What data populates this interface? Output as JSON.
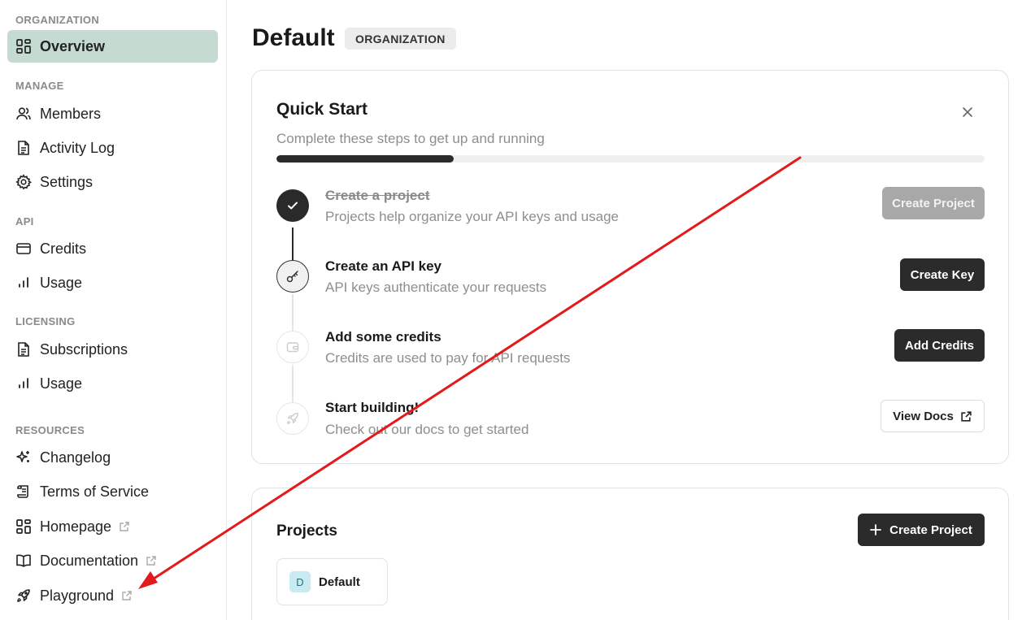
{
  "sidebar": {
    "sections": [
      {
        "label": "ORGANIZATION",
        "items": [
          {
            "label": "Overview",
            "icon": "layout-grid-icon",
            "active": true
          }
        ]
      },
      {
        "label": "MANAGE",
        "items": [
          {
            "label": "Members",
            "icon": "users-icon"
          },
          {
            "label": "Activity Log",
            "icon": "file-text-icon"
          },
          {
            "label": "Settings",
            "icon": "gear-icon"
          }
        ]
      },
      {
        "label": "API",
        "items": [
          {
            "label": "Credits",
            "icon": "credit-card-icon"
          },
          {
            "label": "Usage",
            "icon": "bar-chart-icon"
          }
        ]
      },
      {
        "label": "LICENSING",
        "items": [
          {
            "label": "Subscriptions",
            "icon": "file-text-icon"
          },
          {
            "label": "Usage",
            "icon": "bar-chart-icon"
          }
        ]
      },
      {
        "label": "RESOURCES",
        "items": [
          {
            "label": "Changelog",
            "icon": "sparkles-icon"
          },
          {
            "label": "Terms of Service",
            "icon": "scroll-icon"
          },
          {
            "label": "Homepage",
            "icon": "layout-grid-icon",
            "external": true
          },
          {
            "label": "Documentation",
            "icon": "book-open-icon",
            "external": true
          },
          {
            "label": "Playground",
            "icon": "rocket-icon",
            "external": true
          }
        ]
      }
    ]
  },
  "header": {
    "title": "Default",
    "badge": "ORGANIZATION"
  },
  "quick_start": {
    "title": "Quick Start",
    "subtitle": "Complete these steps to get up and running",
    "progress": 0.25,
    "steps": [
      {
        "title": "Create a project",
        "description": "Projects help organize your API keys and usage",
        "status": "done",
        "button": "Create Project"
      },
      {
        "title": "Create an API key",
        "description": "API keys authenticate your requests",
        "status": "current",
        "button": "Create Key"
      },
      {
        "title": "Add some credits",
        "description": "Credits are used to pay for API requests",
        "status": "todo",
        "button": "Add Credits"
      },
      {
        "title": "Start building!",
        "description": "Check out our docs to get started",
        "status": "todo",
        "button": "View Docs"
      }
    ]
  },
  "projects": {
    "title": "Projects",
    "create_button": "Create Project",
    "items": [
      {
        "initial": "D",
        "name": "Default"
      }
    ]
  },
  "colors": {
    "active_nav": "#c5dbd1",
    "primary_button": "#2b2b2b",
    "annotation_arrow": "#e3191c"
  }
}
